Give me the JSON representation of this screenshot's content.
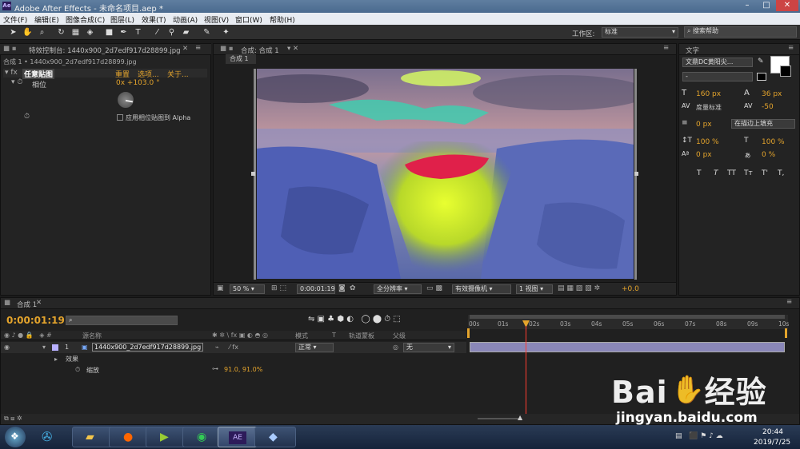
{
  "app": {
    "title": "Adobe After Effects - 未命名项目.aep *",
    "logo": "Ae"
  },
  "menu": [
    "文件(F)",
    "编辑(E)",
    "图像合成(C)",
    "图层(L)",
    "效果(T)",
    "动画(A)",
    "视图(V)",
    "窗口(W)",
    "帮助(H)"
  ],
  "toolbar": {
    "workspace_label": "工作区:",
    "workspace_value": "标准",
    "search_placeholder": "搜索帮助"
  },
  "effects_panel": {
    "tab": "特效控制台: 1440x900_2d7edf917d28899.jpg",
    "breadcrumb": "合成 1 • 1440x900_2d7edf917d28899.jpg",
    "effect_name": "任意贴图",
    "reset": "重置",
    "options": "选项...",
    "about": "关于...",
    "phase_label": "相位",
    "phase_value": "0x +103.0 °",
    "checkbox_label": "应用相位贴图到 Alpha"
  },
  "comp_panel": {
    "tab": "合成: 合成 1",
    "subtab": "合成 1",
    "zoom": "50 %",
    "timecode": "0:00:01:19",
    "resolution": "全分辨率",
    "camera": "有效摄像机",
    "views": "1 视图",
    "exposure": "+0.0"
  },
  "char_panel": {
    "tab": "文字",
    "font": "文鼎DC黄阳尖...",
    "style": "-",
    "size": "160 px",
    "leading": "36 px",
    "kerning": "度量标准",
    "tracking": "-50",
    "stroke": "0 px",
    "stroke_mode": "在描边上填充",
    "vscale": "100 %",
    "hscale": "100 %",
    "baseline": "0 px",
    "tsume": "0 %",
    "styles": [
      "T",
      "T",
      "TT",
      "Tт",
      "T'",
      "T,"
    ]
  },
  "timeline": {
    "tab": "合成 1",
    "timecode": "0:00:01:19",
    "search_placeholder": "",
    "col_source": "源名称",
    "col_mode": "模式",
    "col_track": "轨道蒙板",
    "col_parent": "父级",
    "layer_num": "1",
    "layer_name": "1440x900_2d7edf917d28899.jpg",
    "layer_mode": "正常",
    "layer_parent": "无",
    "effects_label": "效果",
    "scale_label": "缩放",
    "scale_value": "91.0, 91.0%",
    "ruler": [
      "00s",
      "01s",
      "02s",
      "03s",
      "04s",
      "05s",
      "06s",
      "07s",
      "08s",
      "09s",
      "10s"
    ]
  },
  "taskbar": {
    "time": "20:44",
    "date": "2019/7/25",
    "ae_label": "AE"
  },
  "watermark": {
    "brand": "Bai",
    "brand2": "经验",
    "url": "jingyan.baidu.com"
  },
  "colors": {
    "accent": "#e4a42c",
    "playhead": "#ff3b2f",
    "clip": "#8a87b8"
  }
}
